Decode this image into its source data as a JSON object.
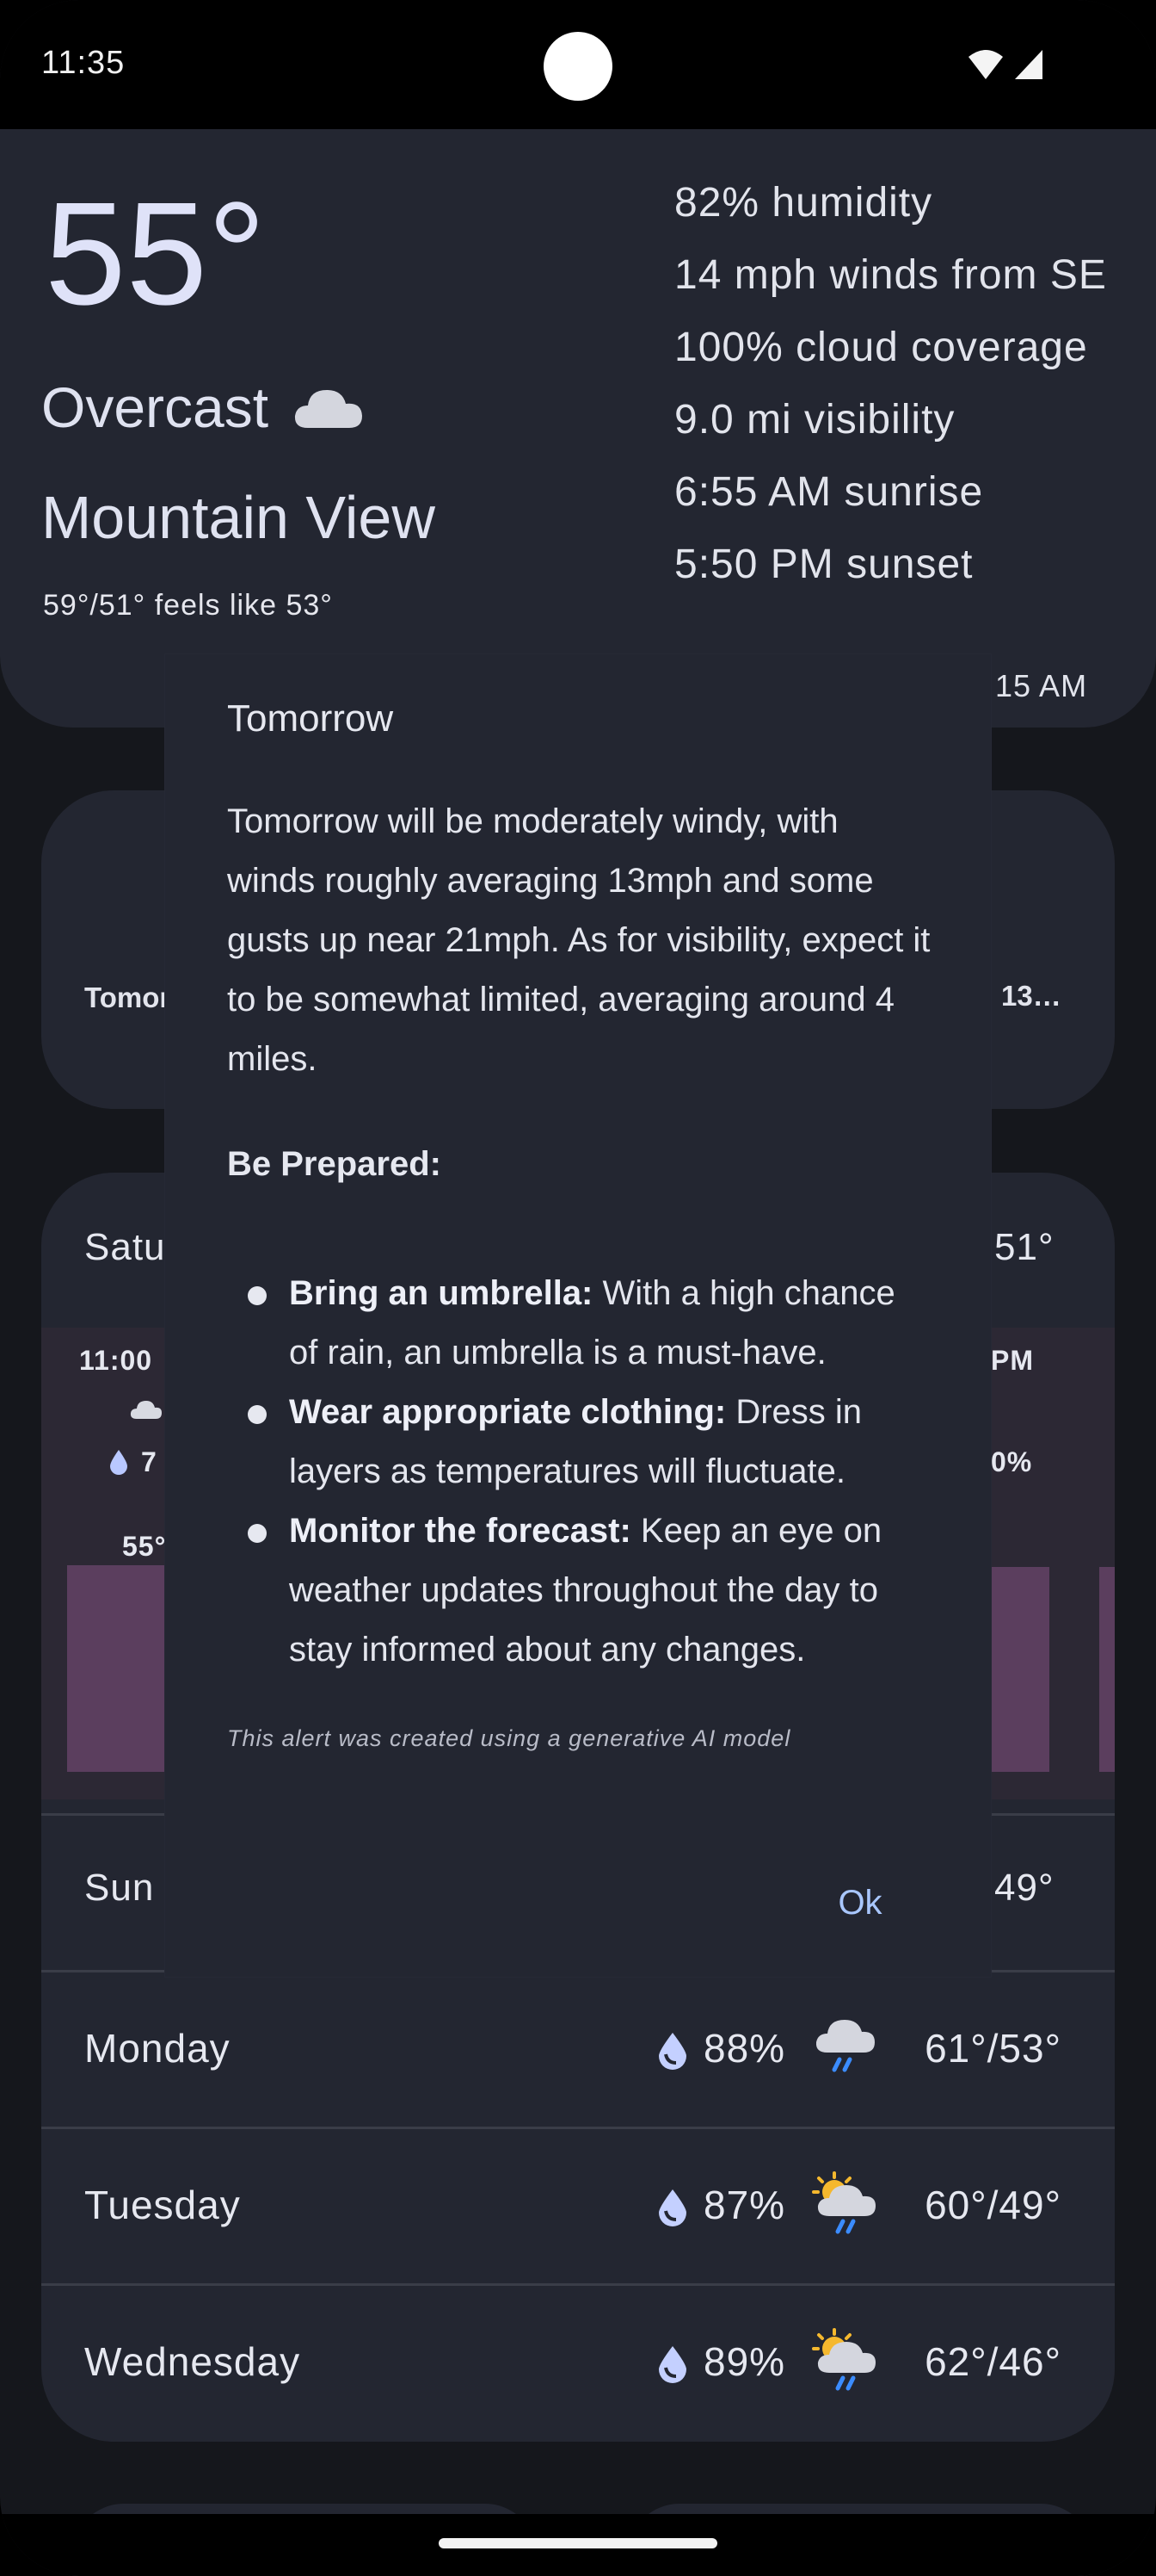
{
  "status_bar": {
    "time": "11:35"
  },
  "current": {
    "temperature": "55°",
    "condition": "Overcast",
    "condition_icon": "cloud-icon",
    "city": "Mountain View",
    "hi_lo_feels": "59°/51° feels like 53°",
    "stats": [
      "82% humidity",
      "14 mph winds from SE",
      "100% cloud coverage",
      "9.0 mi visibility",
      "6:55 AM sunrise",
      "5:50 PM sunset"
    ],
    "updated_partial": ":15 AM"
  },
  "summary_card": {
    "left_partial": "Tomor",
    "right_partial": "13…"
  },
  "forecast": {
    "saturday_partial": "Satu",
    "saturday_hilo_partial": "51°",
    "hour_partial": "11:00",
    "pm_partial": "PM",
    "precip_partial": "7",
    "precip_right_partial": "0%",
    "temp_partial": "55°",
    "sunday_partial": "Sun",
    "sunday_hilo_partial": "49°",
    "days": [
      {
        "name": "Monday",
        "precip": "88%",
        "icon": "rain-cloud-icon",
        "hilo": "61°/53°"
      },
      {
        "name": "Tuesday",
        "precip": "87%",
        "icon": "sun-rain-cloud-icon",
        "hilo": "60°/49°"
      },
      {
        "name": "Wednesday",
        "precip": "89%",
        "icon": "sun-rain-cloud-icon",
        "hilo": "62°/46°"
      }
    ]
  },
  "dialog": {
    "title": "Tomorrow",
    "body": "Tomorrow will be moderately windy, with winds roughly averaging 13mph and some gusts up near 21mph. As for visibility, expect it to be somewhat limited, averaging around 4 miles.",
    "prepared_heading": "Be Prepared:",
    "tips": [
      {
        "title": "Bring an umbrella:",
        "text": " With a high chance of rain, an umbrella is a must-have."
      },
      {
        "title": "Wear appropriate clothing:",
        "text": " Dress in layers as temperatures will fluctuate."
      },
      {
        "title": "Monitor the forecast:",
        "text": " Keep an eye on weather updates throughout the day to stay informed about any changes."
      }
    ],
    "disclaimer": "This alert was created using a generative AI model",
    "ok_label": "Ok"
  }
}
